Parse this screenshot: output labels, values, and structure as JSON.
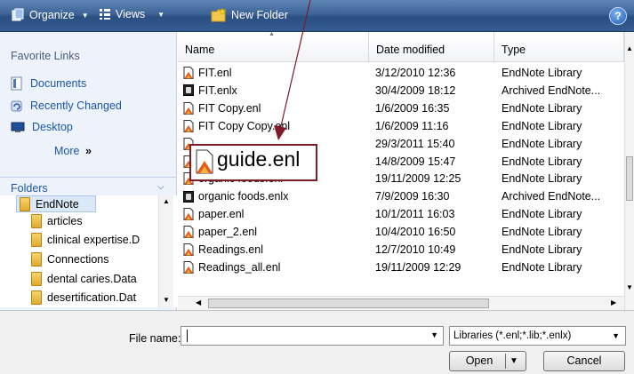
{
  "toolbar": {
    "organize_label": "Organize",
    "views_label": "Views",
    "new_folder_label": "New Folder",
    "help_label": "?"
  },
  "favorite_links": {
    "title": "Favorite Links",
    "items": [
      {
        "label": "Documents",
        "icon": "documents-icon"
      },
      {
        "label": "Recently Changed",
        "icon": "recently-changed-icon"
      },
      {
        "label": "Desktop",
        "icon": "desktop-icon"
      }
    ],
    "more_label": "More",
    "more_glyph": "»"
  },
  "folders": {
    "title": "Folders",
    "items": [
      {
        "label": "EndNote",
        "selected": true
      },
      {
        "label": "articles"
      },
      {
        "label": "clinical expertise.D"
      },
      {
        "label": "Connections"
      },
      {
        "label": "dental caries.Data"
      },
      {
        "label": "desertification.Dat"
      }
    ]
  },
  "columns": {
    "name": "Name",
    "date_modified": "Date modified",
    "type": "Type"
  },
  "files": [
    {
      "name": "FIT.enl",
      "date": "3/12/2010 12:36",
      "type": "EndNote Library",
      "icon": "enl"
    },
    {
      "name": "FIT.enlx",
      "date": "30/4/2009 18:12",
      "type": "Archived EndNote...",
      "icon": "enlx"
    },
    {
      "name": "FIT Copy.enl",
      "date": "1/6/2009 16:35",
      "type": "EndNote Library",
      "icon": "enl"
    },
    {
      "name": "FIT Copy Copy.enl",
      "date": "1/6/2009 11:16",
      "type": "EndNote Library",
      "icon": "enl"
    },
    {
      "name": "",
      "date": "29/3/2011 15:40",
      "type": "EndNote Library",
      "icon": "enl"
    },
    {
      "name": "",
      "date": "14/8/2009 15:47",
      "type": "EndNote Library",
      "icon": "enl"
    },
    {
      "name": "organic foods.enl",
      "date": "19/11/2009 12:25",
      "type": "EndNote Library",
      "icon": "enl"
    },
    {
      "name": "organic foods.enlx",
      "date": "7/9/2009 16:30",
      "type": "Archived EndNote...",
      "icon": "enlx"
    },
    {
      "name": "paper.enl",
      "date": "10/1/2011 16:03",
      "type": "EndNote Library",
      "icon": "enl"
    },
    {
      "name": "paper_2.enl",
      "date": "10/4/2010 16:50",
      "type": "EndNote Library",
      "icon": "enl"
    },
    {
      "name": "Readings.enl",
      "date": "12/7/2010 10:49",
      "type": "EndNote Library",
      "icon": "enl"
    },
    {
      "name": "Readings_all.enl",
      "date": "19/11/2009 12:29",
      "type": "EndNote Library",
      "icon": "enl"
    }
  ],
  "callout": {
    "text": "guide.enl",
    "border_color": "#7d1b29"
  },
  "bottom": {
    "file_name_label": "File name:",
    "file_name_value": "",
    "file_type_value": "Libraries (*.enl;*.lib;*.enlx)",
    "open_label": "Open",
    "cancel_label": "Cancel"
  },
  "colors": {
    "toolbar": "#3d6397",
    "left_pane": "#eef3fb",
    "link": "#1a55a8"
  }
}
